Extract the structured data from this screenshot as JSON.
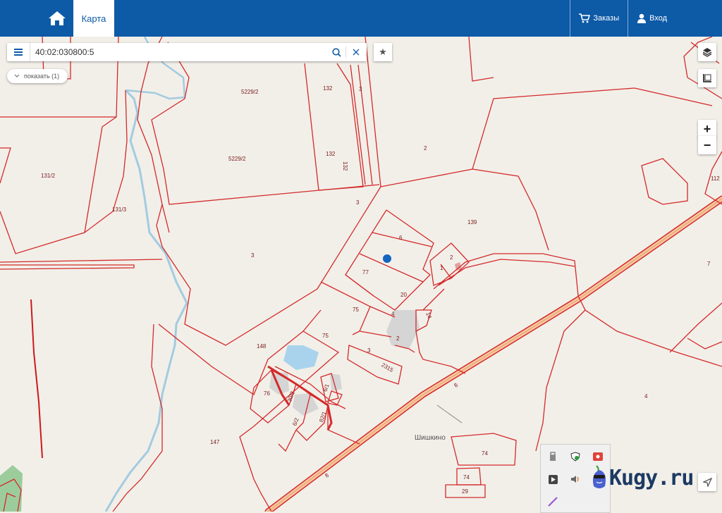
{
  "header": {
    "tab_map": "Карта",
    "orders_label": "Заказы",
    "login_label": "Вход"
  },
  "search": {
    "value": "40:02:030800:5"
  },
  "show_button": "показать (1)",
  "map": {
    "parcel_labels": [
      "5229/2",
      "132",
      "3",
      "5229/2",
      "132",
      "132",
      "2",
      "131/2",
      "131/3",
      "3",
      "3",
      "6",
      "139",
      "2",
      "1",
      "77",
      "20",
      "7",
      "75",
      "4",
      "14",
      "112",
      "2",
      "75",
      "3",
      "148",
      "2315",
      "6/1",
      "76",
      "30/2",
      "6/2",
      "82/1",
      "147",
      "8",
      "8",
      "4",
      "74",
      "74",
      "29"
    ],
    "place_label": "Шишкино"
  },
  "zoom": {
    "in": "+",
    "out": "−"
  },
  "watermark": "Kugy.ru",
  "colors": {
    "header": "#0d5aa7",
    "parcel_line": "#d42a2a",
    "road": "#f0a070",
    "river": "#a3cbe0",
    "marker": "#1565c0"
  }
}
